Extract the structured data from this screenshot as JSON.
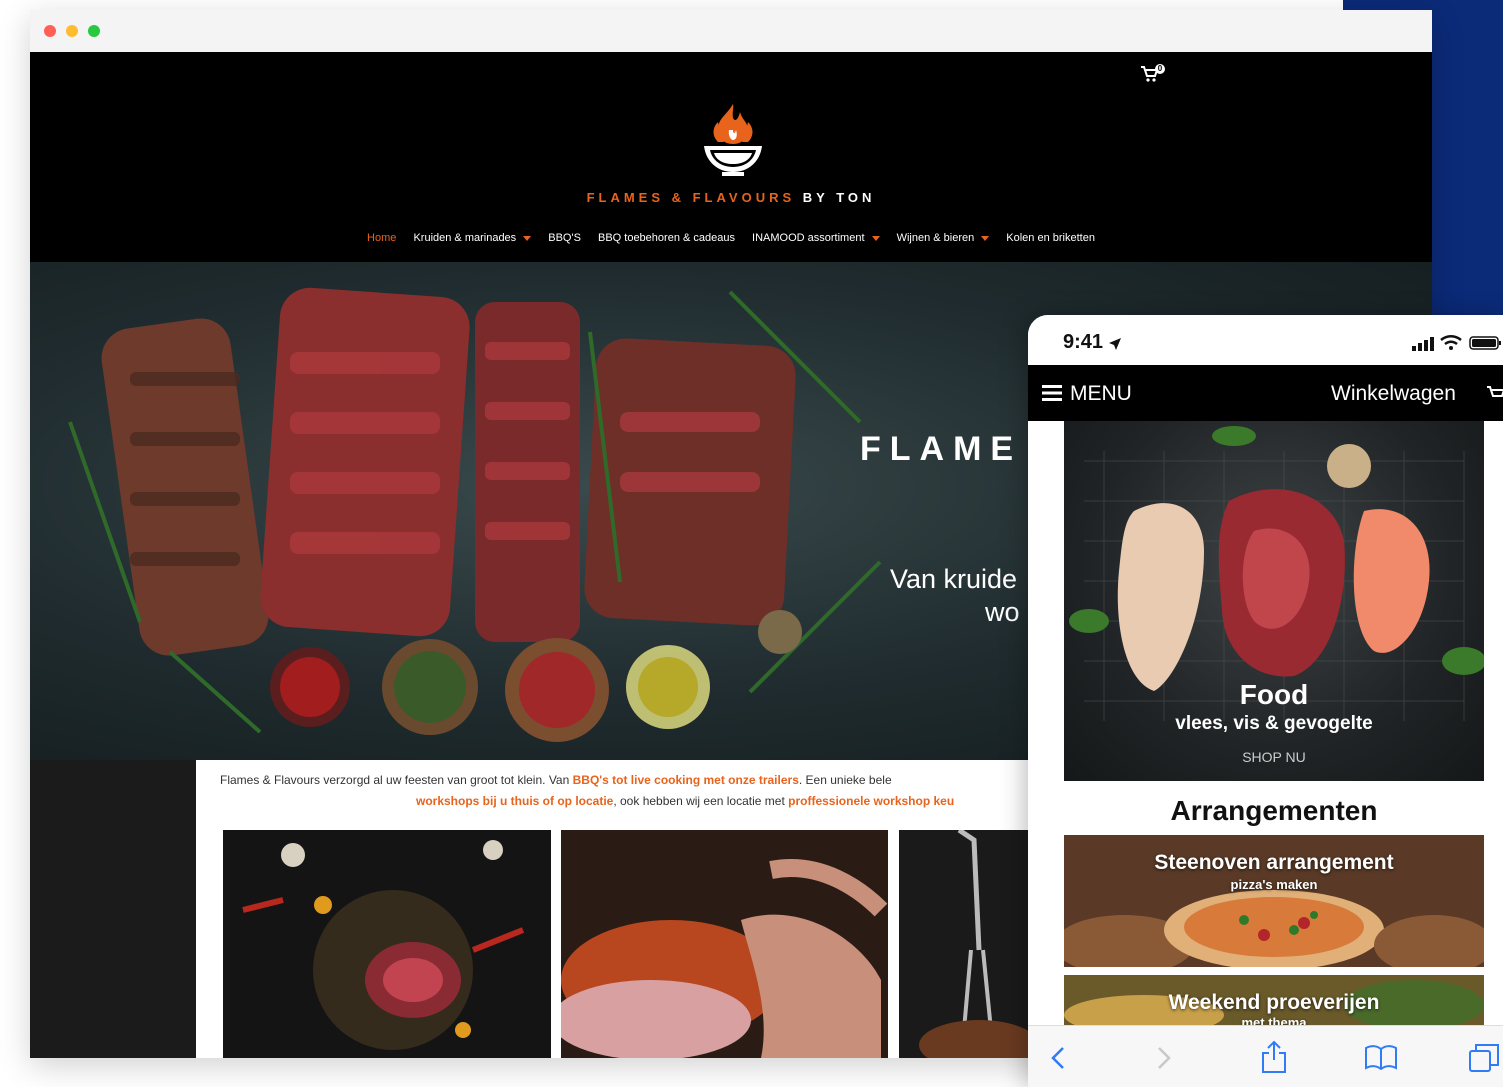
{
  "colors": {
    "accent": "#e8631c",
    "header_bg": "#000000",
    "corner_panel": "#0b2a78",
    "ios_blue": "#2f7cf6"
  },
  "desktop": {
    "cart_count": "0",
    "brand": {
      "part1": "FLAMES & FLAVOURS",
      "part2": "BY TON"
    },
    "nav": [
      {
        "label": "Home",
        "active": true,
        "dropdown": false
      },
      {
        "label": "Kruiden & marinades",
        "dropdown": true
      },
      {
        "label": "BBQ'S",
        "dropdown": false
      },
      {
        "label": "BBQ toebehoren & cadeaus",
        "dropdown": false
      },
      {
        "label": "INAMOOD assortiment",
        "dropdown": true
      },
      {
        "label": "Wijnen & bieren",
        "dropdown": true
      },
      {
        "label": "Kolen en briketten",
        "dropdown": false
      }
    ],
    "hero": {
      "title": "FLAME",
      "subtitle_line1": "Van kruide",
      "subtitle_line2": "wo"
    },
    "intro": {
      "line1_a": "Flames & Flavours verzorgd al uw feesten van groot tot klein. Van ",
      "line1_hl": "BBQ's tot live cooking met onze trailers",
      "line1_b": ". Een unieke bele",
      "line2_hl1": "workshops bij u thuis of op locatie",
      "line2_a": ", ook hebben wij een locatie met ",
      "line2_hl2": "proffessionele workshop keu"
    }
  },
  "mobile": {
    "time": "9:41",
    "menu_label": "MENU",
    "cart_label": "Winkelwagen",
    "hero": {
      "title": "Food",
      "subtitle": "vlees, vis & gevogelte",
      "cta": "SHOP NU"
    },
    "section_title": "Arrangementen",
    "arrangements": [
      {
        "name": "Steenoven arrangement",
        "sub": "pizza's maken"
      },
      {
        "name": "Weekend proeverijen",
        "sub": "met thema"
      }
    ]
  }
}
